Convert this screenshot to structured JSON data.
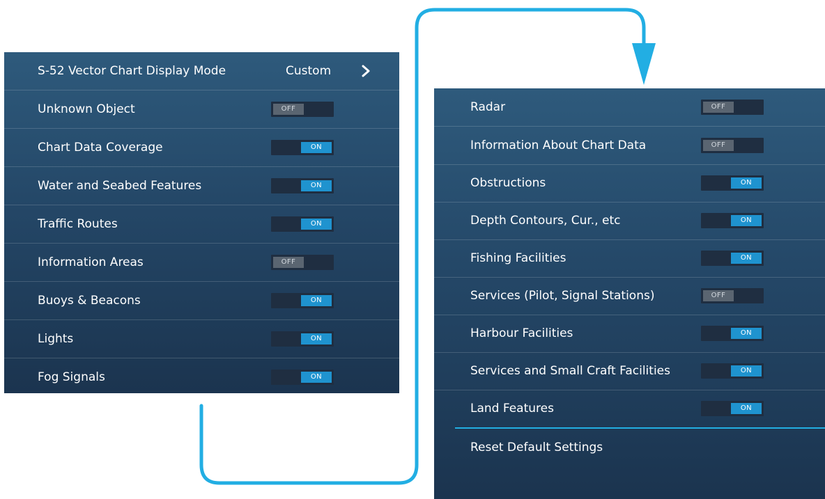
{
  "left_panel": {
    "mode_row": {
      "label": "S-52 Vector Chart Display Mode",
      "value": "Custom"
    },
    "toggles": [
      {
        "label": "Unknown Object",
        "state": "OFF"
      },
      {
        "label": "Chart Data Coverage",
        "state": "ON"
      },
      {
        "label": "Water and Seabed Features",
        "state": "ON"
      },
      {
        "label": "Traffic Routes",
        "state": "ON"
      },
      {
        "label": "Information Areas",
        "state": "OFF"
      },
      {
        "label": "Buoys & Beacons",
        "state": "ON"
      },
      {
        "label": "Lights",
        "state": "ON"
      },
      {
        "label": "Fog Signals",
        "state": "ON"
      }
    ]
  },
  "right_panel": {
    "toggles": [
      {
        "label": "Radar",
        "state": "OFF"
      },
      {
        "label": "Information About Chart Data",
        "state": "OFF"
      },
      {
        "label": "Obstructions",
        "state": "ON"
      },
      {
        "label": "Depth Contours, Cur., etc",
        "state": "ON"
      },
      {
        "label": "Fishing Facilities",
        "state": "ON"
      },
      {
        "label": "Services (Pilot, Signal Stations)",
        "state": "OFF"
      },
      {
        "label": "Harbour Facilities",
        "state": "ON"
      },
      {
        "label": "Services and Small Craft Facilities",
        "state": "ON"
      },
      {
        "label": "Land Features",
        "state": "ON"
      }
    ],
    "reset_label": "Reset Default Settings"
  },
  "icons": {
    "chevron": "chevron-right-icon",
    "connector": "flow-arrow-icon"
  },
  "colors": {
    "accent": "#1f93cf",
    "connector": "#22aee3",
    "panel_top": "#2e5a7c",
    "panel_bottom": "#1b344f",
    "toggle_off_knob": "#5a6571"
  }
}
